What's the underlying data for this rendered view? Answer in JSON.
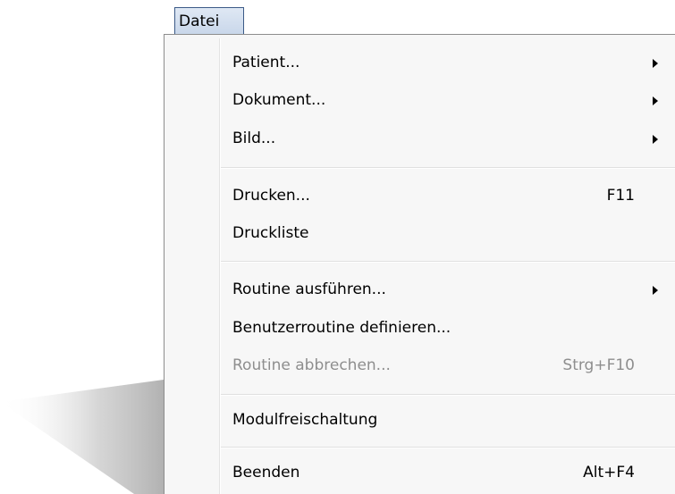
{
  "menubar": {
    "datei_label": "Datei"
  },
  "menu": {
    "items": [
      {
        "label": "Patient...",
        "shortcut": "",
        "submenu": true,
        "enabled": true
      },
      {
        "label": "Dokument...",
        "shortcut": "",
        "submenu": true,
        "enabled": true
      },
      {
        "label": "Bild...",
        "shortcut": "",
        "submenu": true,
        "enabled": true
      },
      {
        "label": "Drucken...",
        "shortcut": "F11",
        "submenu": false,
        "enabled": true
      },
      {
        "label": "Druckliste",
        "shortcut": "",
        "submenu": false,
        "enabled": true
      },
      {
        "label": "Routine ausführen...",
        "shortcut": "",
        "submenu": true,
        "enabled": true
      },
      {
        "label": "Benutzerroutine definieren...",
        "shortcut": "",
        "submenu": false,
        "enabled": true
      },
      {
        "label": "Routine abbrechen...",
        "shortcut": "Strg+F10",
        "submenu": false,
        "enabled": false
      },
      {
        "label": "Modulfreischaltung",
        "shortcut": "",
        "submenu": false,
        "enabled": true
      },
      {
        "label": "Beenden",
        "shortcut": "Alt+F4",
        "submenu": false,
        "enabled": true
      }
    ]
  },
  "colors": {
    "menu_background": "#f7f7f7",
    "disabled_text": "#8e8e8e",
    "menubar_highlight": "#c9d7ea"
  }
}
